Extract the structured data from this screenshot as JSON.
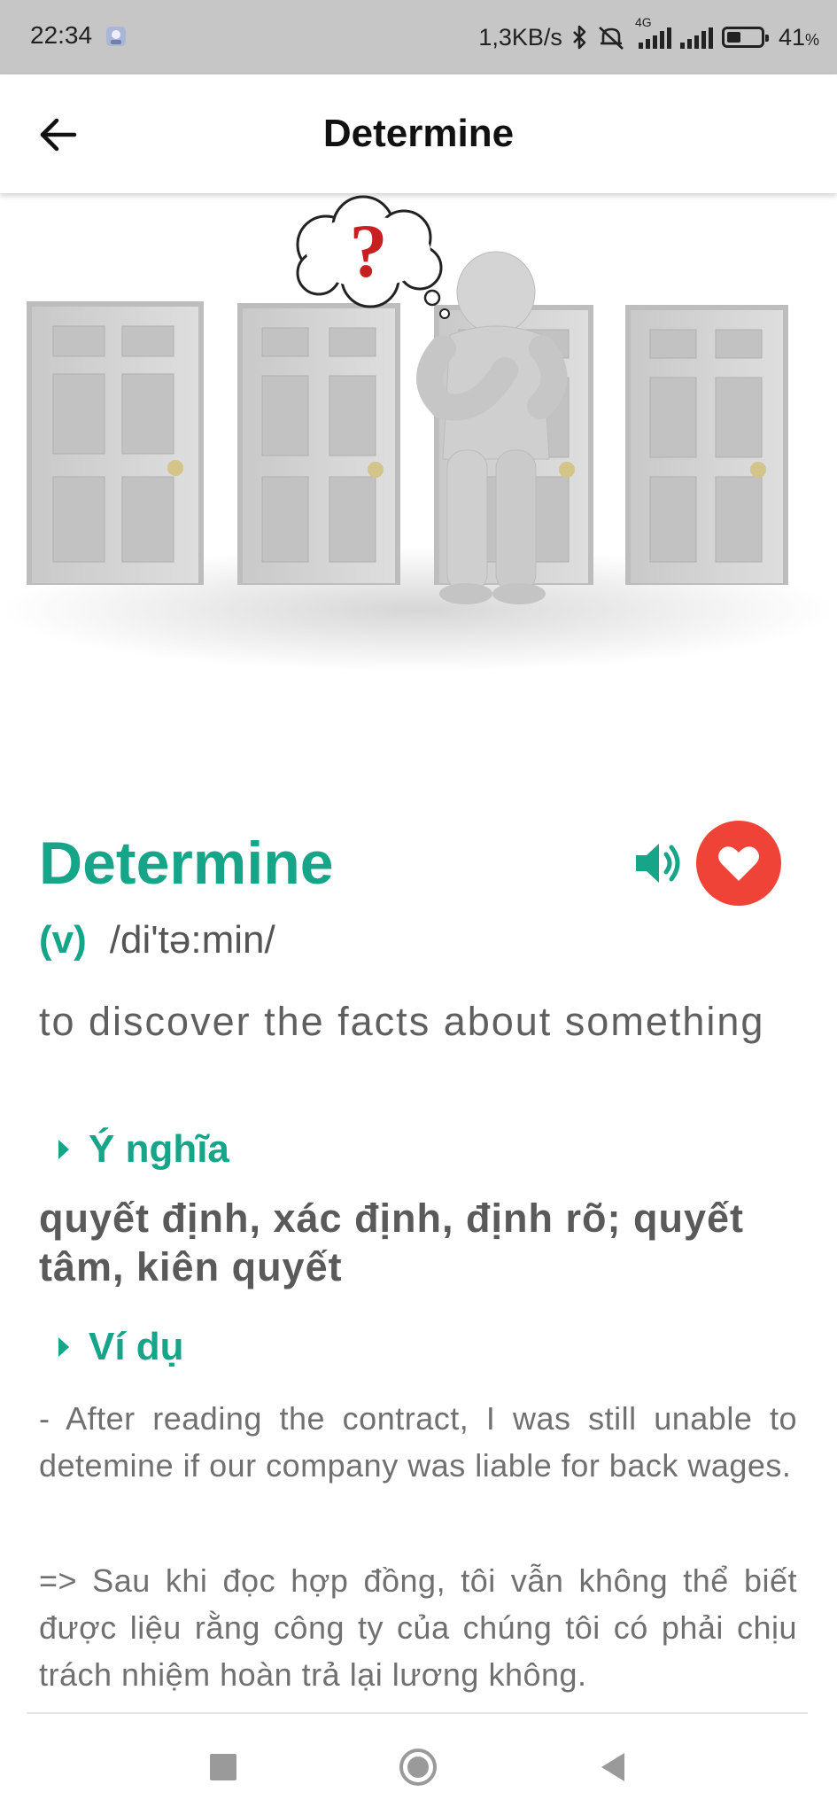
{
  "status_bar": {
    "time": "22:34",
    "network_speed": "1,3KB/s",
    "network_type": "4G",
    "battery_percent": "41",
    "battery_unit": "%",
    "battery_level": 0.41,
    "icons": [
      "app-icon",
      "bluetooth-icon",
      "mute-icon",
      "signal-icon",
      "signal-icon",
      "battery-icon"
    ]
  },
  "app_bar": {
    "title": "Determine",
    "back_icon": "arrow-left-icon"
  },
  "illustration": {
    "question_mark": "?"
  },
  "word": {
    "text": "Determine",
    "part_of_speech": "(v)",
    "phonetic": "/di'tə:min/",
    "definition": "to discover the facts about something",
    "speaker_icon": "speaker-icon",
    "favorite_icon": "heart-icon"
  },
  "sections": {
    "meaning_label": "Ý nghĩa",
    "meaning": "quyết định, xác định, định rõ; quyết tâm, kiên quyết",
    "example_label": "Ví dụ",
    "example_en": "- After reading the contract, I was still unable to detemine if our company was liable for back wages.",
    "example_vi": "=>  Sau khi đọc hợp đồng, tôi vẫn không thể biết được liệu rằng công ty của chúng tôi có phải chịu trách nhiệm hoàn trả lại lương không."
  },
  "colors": {
    "accent": "#17a589",
    "favorite": "#ee4336",
    "status_bar": "#c6c6c6"
  },
  "nav_bar": {
    "icons": [
      "recents-square-icon",
      "home-circle-icon",
      "back-triangle-icon"
    ]
  }
}
